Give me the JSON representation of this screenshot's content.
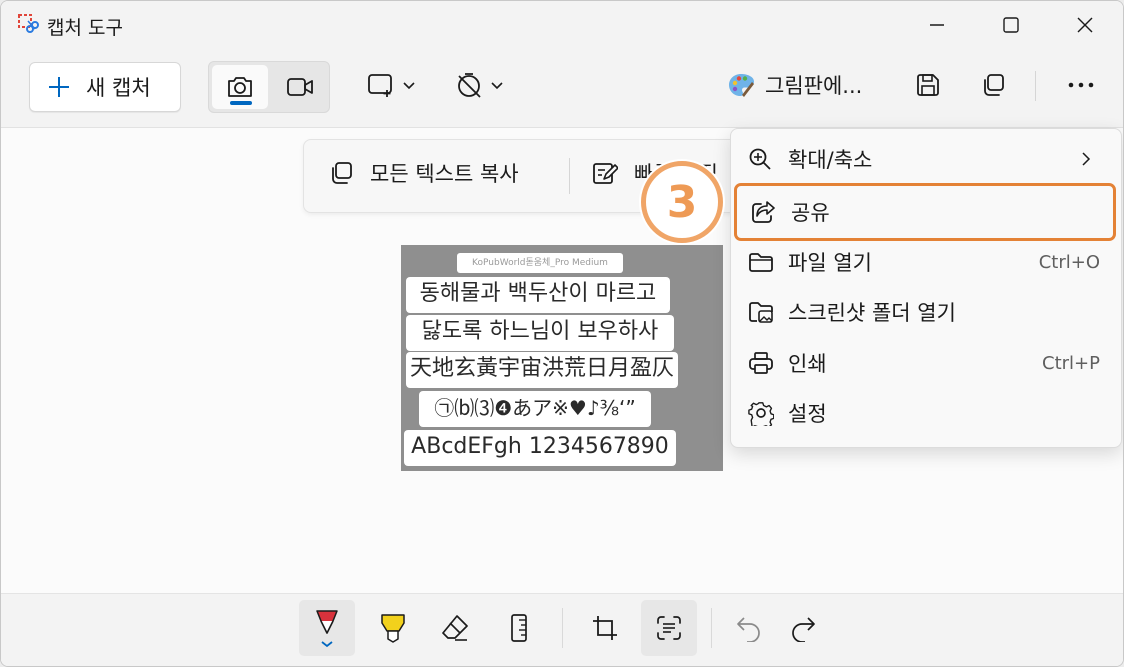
{
  "window": {
    "title": "캡처 도구"
  },
  "toolbar": {
    "new_capture_label": "새 캡처",
    "open_in_paint_label": "그림판에..."
  },
  "text_actions": {
    "copy_all_text_label": "모든 텍스트 복사",
    "quick_edit_label": "빠른 편집"
  },
  "badge": {
    "step": "3"
  },
  "screenshot": {
    "caption": "KoPubWorld돋움체_Pro Medium",
    "lines": [
      "동해물과 백두산이 마르고",
      "닳도록 하느님이 보우하사",
      "天地玄黃宇宙洪荒日月盈仄",
      "㉠⒝⑶❹あア※♥♪⅜‘”",
      "ABcdEFgh 1234567890"
    ]
  },
  "menu": {
    "items": [
      {
        "label": "확대/축소",
        "shortcut": "",
        "icon": "zoom-icon"
      },
      {
        "label": "공유",
        "shortcut": "",
        "icon": "share-icon"
      },
      {
        "label": "파일 열기",
        "shortcut": "Ctrl+O",
        "icon": "folder-icon"
      },
      {
        "label": "스크린샷 폴더 열기",
        "shortcut": "",
        "icon": "image-folder-icon"
      },
      {
        "label": "인쇄",
        "shortcut": "Ctrl+P",
        "icon": "printer-icon"
      },
      {
        "label": "설정",
        "shortcut": "",
        "icon": "gear-icon"
      }
    ]
  },
  "colors": {
    "accent": "#0067c0",
    "highlight": "#e48236",
    "pen_red": "#d8323c",
    "highlighter_yellow": "#f2d11c"
  }
}
